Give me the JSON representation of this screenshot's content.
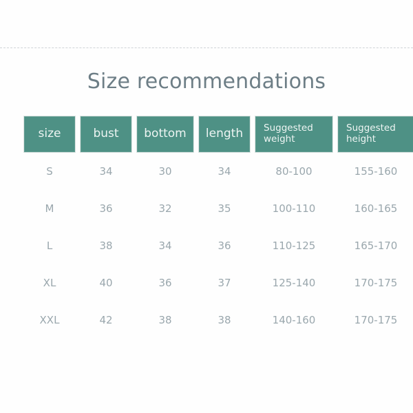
{
  "document": {
    "title": "Size recommendations"
  },
  "table": {
    "headers": [
      {
        "label": "size",
        "style": "single"
      },
      {
        "label": "bust",
        "style": "single"
      },
      {
        "label": "bottom",
        "style": "single"
      },
      {
        "label": "length",
        "style": "single"
      },
      {
        "label": "Suggested weight",
        "style": "wrapped"
      },
      {
        "label": "Suggested height",
        "style": "wrapped"
      }
    ],
    "rows": [
      {
        "size": "S",
        "bust": "34",
        "bottom": "30",
        "length": "34",
        "weight": "80-100",
        "height": "155-160"
      },
      {
        "size": "M",
        "bust": "36",
        "bottom": "32",
        "length": "35",
        "weight": "100-110",
        "height": "160-165"
      },
      {
        "size": "L",
        "bust": "38",
        "bottom": "34",
        "length": "36",
        "weight": "110-125",
        "height": "165-170"
      },
      {
        "size": "XL",
        "bust": "40",
        "bottom": "36",
        "length": "37",
        "weight": "125-140",
        "height": "170-175"
      },
      {
        "size": "XXL",
        "bust": "42",
        "bottom": "38",
        "length": "38",
        "weight": "140-160",
        "height": "170-175"
      }
    ]
  },
  "colors": {
    "header_background": "#4e9185",
    "header_text": "#eef5f3",
    "title_text": "#6d7e86",
    "body_text": "#9aa7ad",
    "divider": "#cfd3d6",
    "page_background": "#fefefe"
  }
}
